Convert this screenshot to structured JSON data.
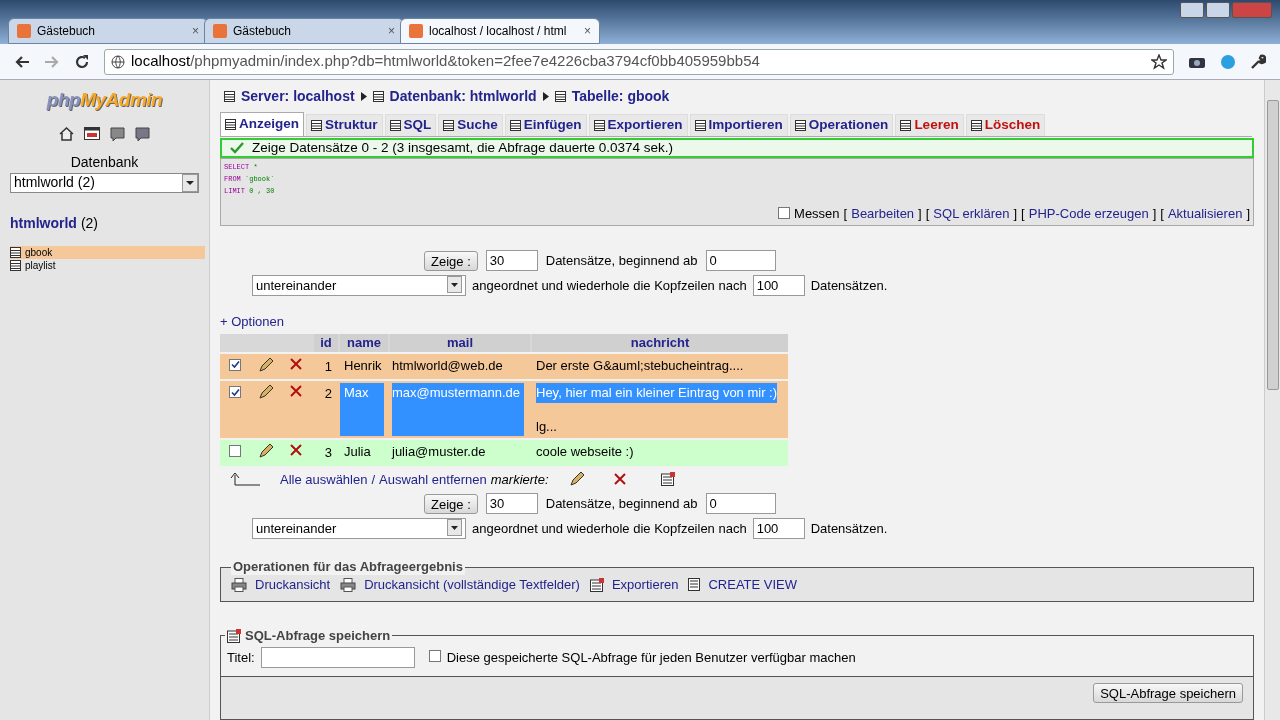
{
  "browser": {
    "tabs": [
      {
        "title": "Gästebuch",
        "selected": false,
        "close": "×"
      },
      {
        "title": "Gästebuch",
        "selected": false,
        "close": "×"
      },
      {
        "title": "localhost / localhost / html",
        "selected": true,
        "close": "×"
      }
    ],
    "address": {
      "host": "localhost",
      "path": "/phpmyadmin/index.php?db=htmlworld&token=2fee7e4226cba3794cf0bb405959bb54"
    }
  },
  "sidebar": {
    "logo_php": "php",
    "logo_rest": "MyAdmin",
    "db_label": "Datenbank",
    "db_select": "htmlworld (2)",
    "db_name": "htmlworld",
    "db_count": "(2)",
    "tables": [
      {
        "name": "gbook",
        "selected": true
      },
      {
        "name": "playlist",
        "selected": false
      }
    ]
  },
  "breadcrumb": [
    {
      "label": "Server: localhost"
    },
    {
      "label": "Datenbank: htmlworld"
    },
    {
      "label": "Tabelle: gbook"
    }
  ],
  "tabs": [
    {
      "label": "Anzeigen",
      "selected": true,
      "kind": "normal"
    },
    {
      "label": "Struktur",
      "selected": false,
      "kind": "normal"
    },
    {
      "label": "SQL",
      "selected": false,
      "kind": "normal"
    },
    {
      "label": "Suche",
      "selected": false,
      "kind": "normal"
    },
    {
      "label": "Einfügen",
      "selected": false,
      "kind": "normal"
    },
    {
      "label": "Exportieren",
      "selected": false,
      "kind": "normal"
    },
    {
      "label": "Importieren",
      "selected": false,
      "kind": "normal"
    },
    {
      "label": "Operationen",
      "selected": false,
      "kind": "normal"
    },
    {
      "label": "Leeren",
      "selected": false,
      "kind": "danger"
    },
    {
      "label": "Löschen",
      "selected": false,
      "kind": "danger"
    }
  ],
  "success": "Zeige Datensätze 0 - 2 (3 insgesamt, die Abfrage dauerte 0.0374 sek.)",
  "query": {
    "lines": [
      {
        "keyword": "SELECT",
        "rest": "*"
      },
      {
        "keyword": "FROM",
        "rest": "`gbook`"
      },
      {
        "keyword": "LIMIT",
        "rest": "0 , 30"
      }
    ],
    "measure": {
      "label": "Messen",
      "checked": false
    },
    "links": [
      "Bearbeiten",
      "SQL erklären",
      "PHP-Code erzeugen",
      "Aktualisieren"
    ],
    "open": "[",
    "close": "]"
  },
  "navs": [
    {
      "button": "Zeige :",
      "count": "30",
      "text1": "Datensätze, beginnend ab",
      "start": "0",
      "mode": "untereinander",
      "text2": "angeordnet und wiederhole die Kopfzeilen nach",
      "repeat": "100",
      "text3": "Datensätzen."
    },
    {
      "button": "Zeige :",
      "count": "30",
      "text1": "Datensätze, beginnend ab",
      "start": "0",
      "mode": "untereinander",
      "text2": "angeordnet und wiederhole die Kopfzeilen nach",
      "repeat": "100",
      "text3": "Datensätzen."
    }
  ],
  "options_link": "+ Optionen",
  "table": {
    "columns": [
      "id",
      "name",
      "mail",
      "nachricht"
    ],
    "rows": [
      {
        "checked": true,
        "hovered": false,
        "text_selected": false,
        "id": "1",
        "name": "Henrik",
        "mail": "htmlworld@web.de",
        "nachricht": [
          "Der erste G&auml;stebucheintrag...."
        ]
      },
      {
        "checked": true,
        "hovered": false,
        "text_selected": true,
        "id": "2",
        "name": "Max",
        "mail": "max@mustermann.de",
        "nachricht": [
          "Hey, hier mal ein kleiner Eintrag von mir :)",
          "lg..."
        ]
      },
      {
        "checked": false,
        "hovered": true,
        "text_selected": false,
        "id": "3",
        "name": "Julia",
        "mail": "julia@muster.de",
        "nachricht": [
          "coole webseite :)"
        ]
      }
    ]
  },
  "bulk": {
    "select_all": "Alle auswählen",
    "separator": "/",
    "unselect": "Auswahl entfernen",
    "marked": "markierte:"
  },
  "operations": {
    "legend": "Operationen für das Abfrageergebnis",
    "links": [
      {
        "label": "Druckansicht",
        "kind": "print"
      },
      {
        "label": "Druckansicht (vollständige Textfelder)",
        "kind": "print"
      },
      {
        "label": "Exportieren",
        "kind": "export"
      },
      {
        "label": "CREATE VIEW",
        "kind": "view"
      }
    ]
  },
  "save": {
    "legend": "SQL-Abfrage speichern",
    "title_label": "Titel:",
    "share_label": "Diese gespeicherte SQL-Abfrage für jeden Benutzer verfügbar machen",
    "share_checked": false,
    "button": "SQL-Abfrage speichern"
  }
}
